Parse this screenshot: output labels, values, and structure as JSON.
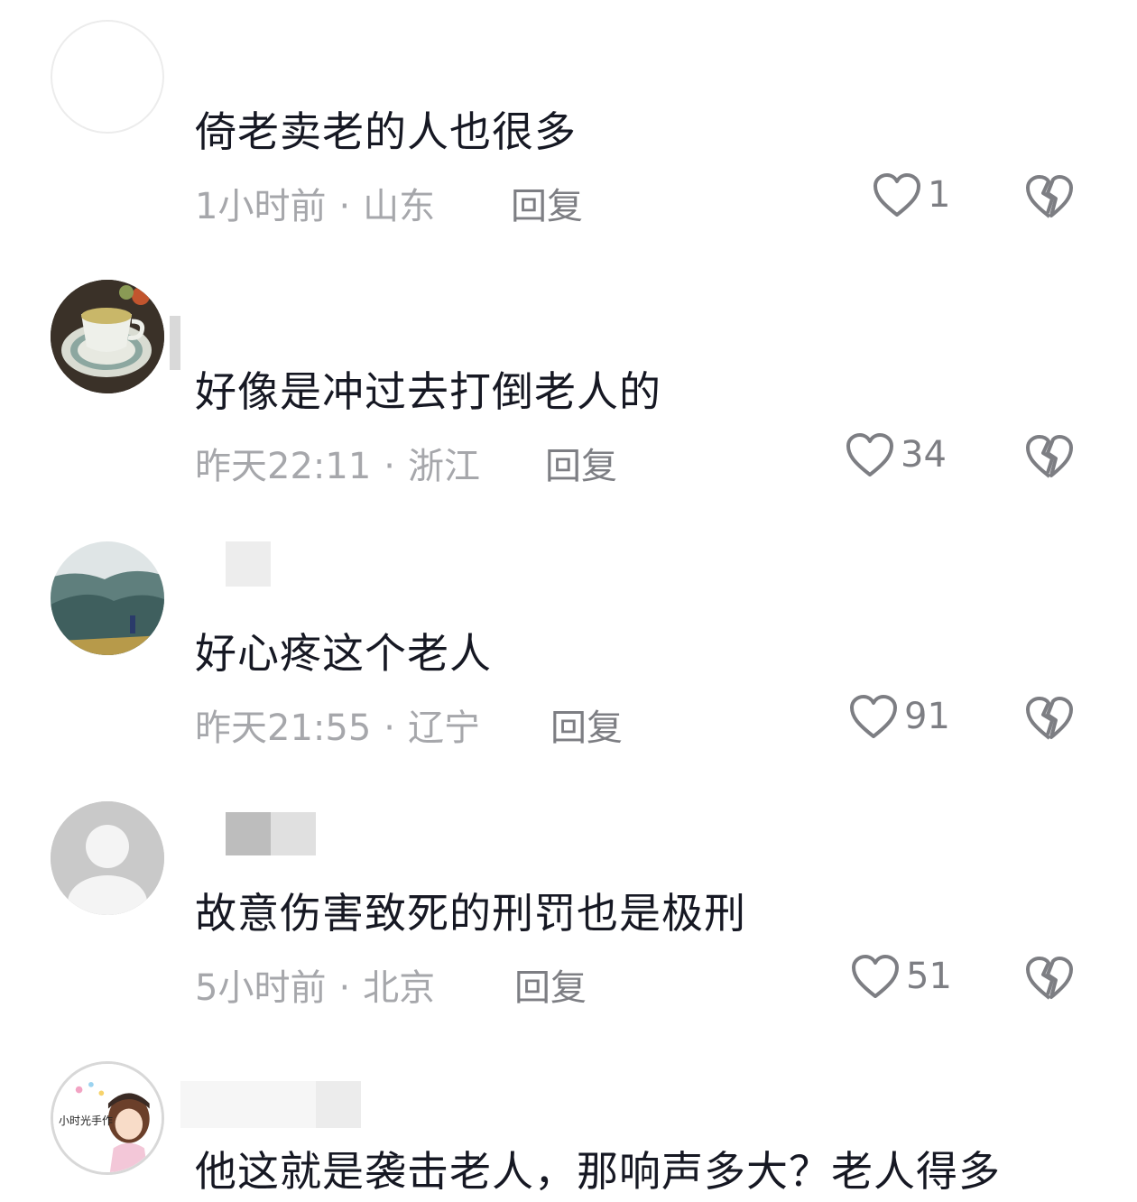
{
  "comments": [
    {
      "text": "倚老卖老的人也很多",
      "time": "1小时前",
      "location": "山东",
      "reply": "回复",
      "likes": "1",
      "avatar": "blank-avatar"
    },
    {
      "text": "好像是冲过去打倒老人的",
      "time": "昨天22:11",
      "location": "浙江",
      "reply": "回复",
      "likes": "34",
      "avatar": "tea-cup-avatar"
    },
    {
      "text": "好心疼这个老人",
      "time": "昨天21:55",
      "location": "辽宁",
      "reply": "回复",
      "likes": "91",
      "avatar": "mountain-avatar"
    },
    {
      "text": "故意伤害致死的刑罚也是极刑",
      "time": "5小时前",
      "location": "北京",
      "reply": "回复",
      "likes": "51",
      "avatar": "default-user-avatar"
    },
    {
      "text": "他这就是袭击老人，那响声多大？老人得多",
      "avatar": "cartoon-girl-avatar",
      "avatar_text": "小时光手作"
    }
  ],
  "separator": "·",
  "icons": {
    "like": "heart-outline-icon",
    "dislike": "broken-heart-icon"
  },
  "colors": {
    "text": "#161823",
    "meta": "#a6a7ab",
    "action": "#7d7e83"
  }
}
